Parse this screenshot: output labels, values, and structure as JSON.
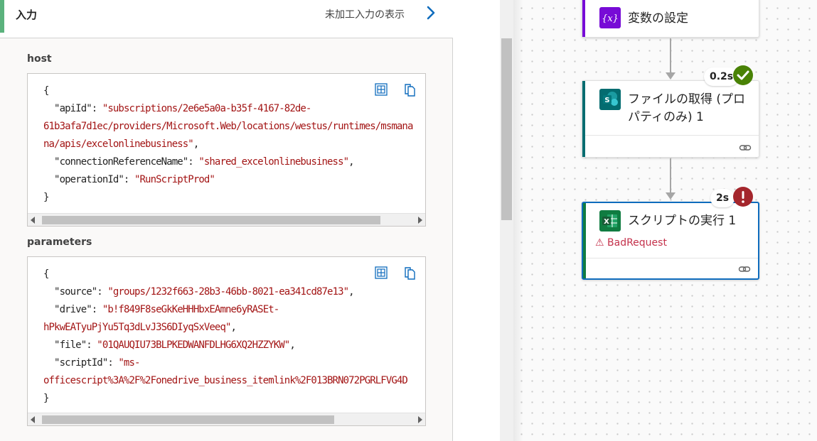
{
  "input_panel": {
    "title": "入力",
    "raw_link": "未加工入力の表示",
    "host": {
      "label": "host",
      "lines": [
        [
          [
            "k",
            "{"
          ]
        ],
        [
          [
            "k",
            "  \"apiId\": "
          ],
          [
            "s",
            "\"subscriptions/2e6e5a0a-b35f-4167-82de-"
          ]
        ],
        [
          [
            "s",
            "61b3afa7d1ec/providers/Microsoft.Web/locations/westus/runtimes/msmana"
          ]
        ],
        [
          [
            "s",
            "na/apis/excelonlinebusiness\""
          ],
          [
            "k",
            ","
          ]
        ],
        [
          [
            "k",
            "  \"connectionReferenceName\": "
          ],
          [
            "s",
            "\"shared_excelonlinebusiness\""
          ],
          [
            "k",
            ","
          ]
        ],
        [
          [
            "k",
            "  \"operationId\": "
          ],
          [
            "s",
            "\"RunScriptProd\""
          ]
        ],
        [
          [
            "k",
            "}"
          ]
        ]
      ]
    },
    "parameters": {
      "label": "parameters",
      "lines": [
        [
          [
            "k",
            "{"
          ]
        ],
        [
          [
            "k",
            "  \"source\": "
          ],
          [
            "s",
            "\"groups/1232f663-28b3-46bb-8021-ea341cd87e13\""
          ],
          [
            "k",
            ","
          ]
        ],
        [
          [
            "k",
            "  \"drive\": "
          ],
          [
            "s",
            "\"b!f849F8seGkKeHHHbxEAmne6yRASEt-"
          ]
        ],
        [
          [
            "s",
            "hPkwEATyuPjYu5Tq3dLvJ3S6DIyqSxVeeq\""
          ],
          [
            "k",
            ","
          ]
        ],
        [
          [
            "k",
            "  \"file\": "
          ],
          [
            "s",
            "\"01QAUQIU73BLPKEDWANFDLHG6XQ2HZZYKW\""
          ],
          [
            "k",
            ","
          ]
        ],
        [
          [
            "k",
            "  \"scriptId\": "
          ],
          [
            "s",
            "\"ms-"
          ]
        ],
        [
          [
            "s",
            "officescript%3A%2F%2Fonedrive_business_itemlink%2F013BRN072PGRLFVG4D"
          ]
        ],
        [
          [
            "k",
            "}"
          ]
        ]
      ]
    }
  },
  "flow": {
    "set_variable": {
      "title": "変数の設定",
      "icon": "variable-icon",
      "color": "#770bd6"
    },
    "get_file": {
      "title_line1": "ファイルの取得 (プロ",
      "title_line2": "パティのみ) 1",
      "duration": "0.2s",
      "status": "succeeded",
      "color": "#036c70"
    },
    "run_script": {
      "title": "スクリプトの実行 1",
      "duration": "2s",
      "status": "failed",
      "error": "BadRequest",
      "color": "#107c41"
    }
  },
  "colors": {
    "success": "#498205",
    "error": "#a4262c",
    "accent_green": "#5bb27d",
    "selection": "#0f6cbd"
  }
}
